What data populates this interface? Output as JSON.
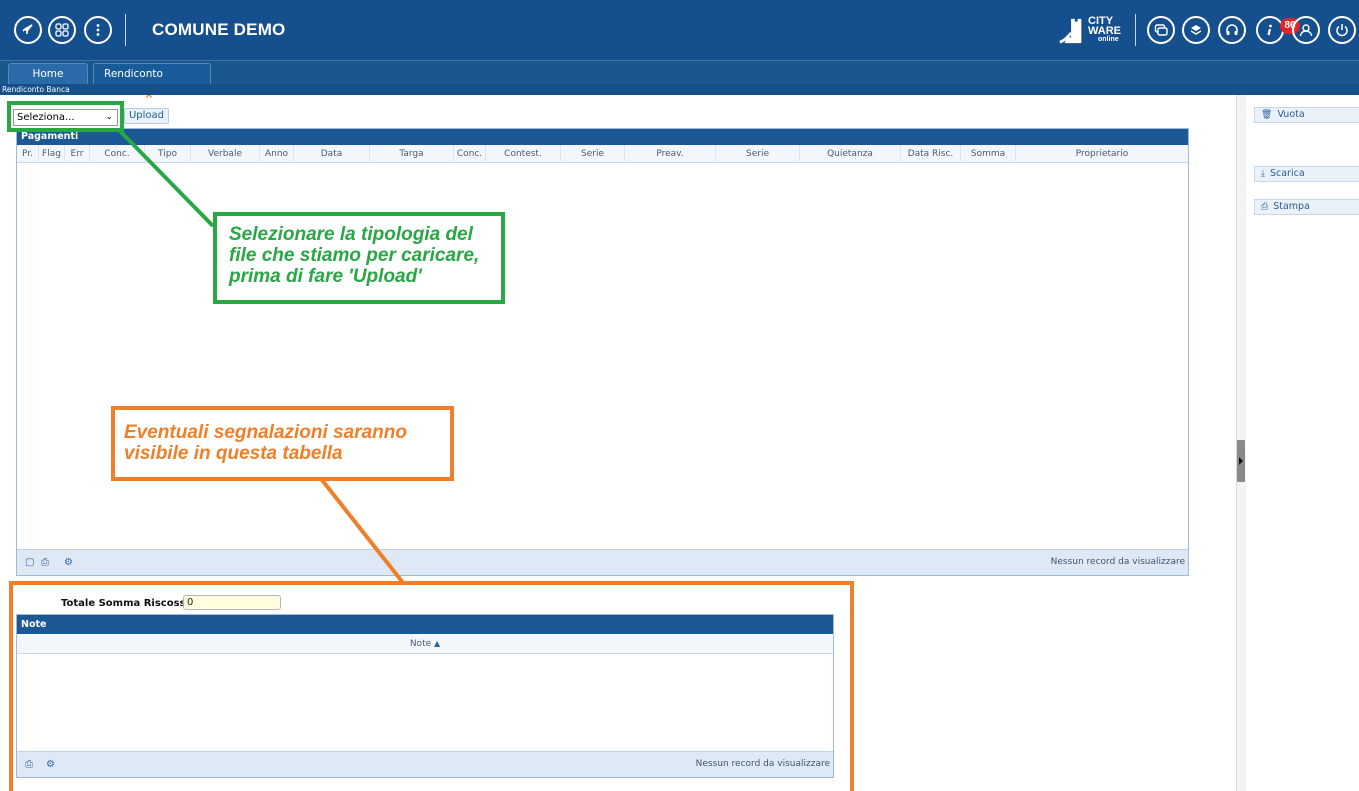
{
  "app": {
    "title": "COMUNE DEMO",
    "logo_line1": "CITY",
    "logo_line2": "WARE",
    "logo_line3": "online",
    "notification_count": "86",
    "accent_color": "#154f8e"
  },
  "tabs": [
    {
      "label": "Home"
    },
    {
      "label": "Rendiconto Banca",
      "close": "×"
    }
  ],
  "breadcrumb": "Rendiconto Banca",
  "toolbar": {
    "select_value": "Seleziona...",
    "upload_label": "Upload"
  },
  "pagamenti": {
    "title": "Pagamenti",
    "columns": [
      "Pr.",
      "Flag",
      "Err",
      "Conc.",
      "Tipo",
      "Verbale",
      "Anno",
      "Data",
      "Targa",
      "Conc.",
      "Contest.",
      "Serie",
      "Preav.",
      "Serie",
      "Quietanza",
      "Data Risc.",
      "Somma",
      "Proprietario"
    ],
    "empty_text": "Nessun record da visualizzare"
  },
  "totale": {
    "label": "Totale Somma Riscossa",
    "value": "0"
  },
  "note": {
    "title": "Note",
    "column": "Note",
    "empty_text": "Nessun record da visualizzare"
  },
  "right_panel": {
    "vuota": "Vuota",
    "scarica": "Scarica",
    "stampa": "Stampa"
  },
  "annotations": {
    "green": {
      "lines": [
        "Selezionare la tipologia del",
        "file che stiamo per caricare,",
        "prima di fare 'Upload'"
      ],
      "color": "#27a844"
    },
    "orange": {
      "lines": [
        "Eventuali segnalazioni saranno",
        "visibile in questa tabella"
      ],
      "color": "#f07f2a"
    }
  }
}
